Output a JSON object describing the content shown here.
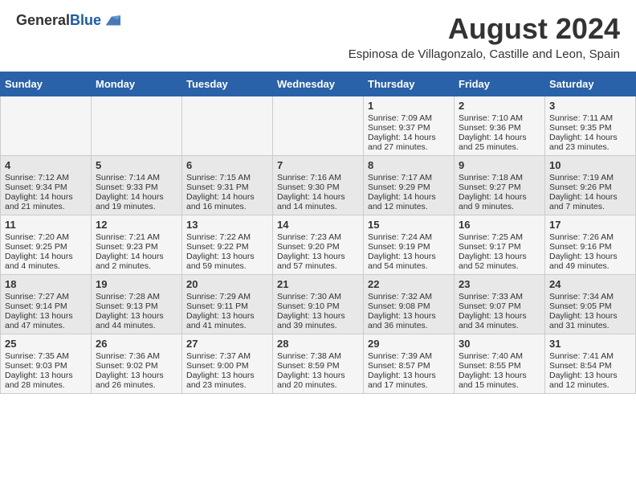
{
  "header": {
    "logo_general": "General",
    "logo_blue": "Blue",
    "month_year": "August 2024",
    "location": "Espinosa de Villagonzalo, Castille and Leon, Spain"
  },
  "days_of_week": [
    "Sunday",
    "Monday",
    "Tuesday",
    "Wednesday",
    "Thursday",
    "Friday",
    "Saturday"
  ],
  "weeks": [
    [
      {
        "day": "",
        "empty": true
      },
      {
        "day": "",
        "empty": true
      },
      {
        "day": "",
        "empty": true
      },
      {
        "day": "",
        "empty": true
      },
      {
        "day": "1",
        "sunrise": "Sunrise: 7:09 AM",
        "sunset": "Sunset: 9:37 PM",
        "daylight": "Daylight: 14 hours and 27 minutes."
      },
      {
        "day": "2",
        "sunrise": "Sunrise: 7:10 AM",
        "sunset": "Sunset: 9:36 PM",
        "daylight": "Daylight: 14 hours and 25 minutes."
      },
      {
        "day": "3",
        "sunrise": "Sunrise: 7:11 AM",
        "sunset": "Sunset: 9:35 PM",
        "daylight": "Daylight: 14 hours and 23 minutes."
      }
    ],
    [
      {
        "day": "4",
        "sunrise": "Sunrise: 7:12 AM",
        "sunset": "Sunset: 9:34 PM",
        "daylight": "Daylight: 14 hours and 21 minutes."
      },
      {
        "day": "5",
        "sunrise": "Sunrise: 7:14 AM",
        "sunset": "Sunset: 9:33 PM",
        "daylight": "Daylight: 14 hours and 19 minutes."
      },
      {
        "day": "6",
        "sunrise": "Sunrise: 7:15 AM",
        "sunset": "Sunset: 9:31 PM",
        "daylight": "Daylight: 14 hours and 16 minutes."
      },
      {
        "day": "7",
        "sunrise": "Sunrise: 7:16 AM",
        "sunset": "Sunset: 9:30 PM",
        "daylight": "Daylight: 14 hours and 14 minutes."
      },
      {
        "day": "8",
        "sunrise": "Sunrise: 7:17 AM",
        "sunset": "Sunset: 9:29 PM",
        "daylight": "Daylight: 14 hours and 12 minutes."
      },
      {
        "day": "9",
        "sunrise": "Sunrise: 7:18 AM",
        "sunset": "Sunset: 9:27 PM",
        "daylight": "Daylight: 14 hours and 9 minutes."
      },
      {
        "day": "10",
        "sunrise": "Sunrise: 7:19 AM",
        "sunset": "Sunset: 9:26 PM",
        "daylight": "Daylight: 14 hours and 7 minutes."
      }
    ],
    [
      {
        "day": "11",
        "sunrise": "Sunrise: 7:20 AM",
        "sunset": "Sunset: 9:25 PM",
        "daylight": "Daylight: 14 hours and 4 minutes."
      },
      {
        "day": "12",
        "sunrise": "Sunrise: 7:21 AM",
        "sunset": "Sunset: 9:23 PM",
        "daylight": "Daylight: 14 hours and 2 minutes."
      },
      {
        "day": "13",
        "sunrise": "Sunrise: 7:22 AM",
        "sunset": "Sunset: 9:22 PM",
        "daylight": "Daylight: 13 hours and 59 minutes."
      },
      {
        "day": "14",
        "sunrise": "Sunrise: 7:23 AM",
        "sunset": "Sunset: 9:20 PM",
        "daylight": "Daylight: 13 hours and 57 minutes."
      },
      {
        "day": "15",
        "sunrise": "Sunrise: 7:24 AM",
        "sunset": "Sunset: 9:19 PM",
        "daylight": "Daylight: 13 hours and 54 minutes."
      },
      {
        "day": "16",
        "sunrise": "Sunrise: 7:25 AM",
        "sunset": "Sunset: 9:17 PM",
        "daylight": "Daylight: 13 hours and 52 minutes."
      },
      {
        "day": "17",
        "sunrise": "Sunrise: 7:26 AM",
        "sunset": "Sunset: 9:16 PM",
        "daylight": "Daylight: 13 hours and 49 minutes."
      }
    ],
    [
      {
        "day": "18",
        "sunrise": "Sunrise: 7:27 AM",
        "sunset": "Sunset: 9:14 PM",
        "daylight": "Daylight: 13 hours and 47 minutes."
      },
      {
        "day": "19",
        "sunrise": "Sunrise: 7:28 AM",
        "sunset": "Sunset: 9:13 PM",
        "daylight": "Daylight: 13 hours and 44 minutes."
      },
      {
        "day": "20",
        "sunrise": "Sunrise: 7:29 AM",
        "sunset": "Sunset: 9:11 PM",
        "daylight": "Daylight: 13 hours and 41 minutes."
      },
      {
        "day": "21",
        "sunrise": "Sunrise: 7:30 AM",
        "sunset": "Sunset: 9:10 PM",
        "daylight": "Daylight: 13 hours and 39 minutes."
      },
      {
        "day": "22",
        "sunrise": "Sunrise: 7:32 AM",
        "sunset": "Sunset: 9:08 PM",
        "daylight": "Daylight: 13 hours and 36 minutes."
      },
      {
        "day": "23",
        "sunrise": "Sunrise: 7:33 AM",
        "sunset": "Sunset: 9:07 PM",
        "daylight": "Daylight: 13 hours and 34 minutes."
      },
      {
        "day": "24",
        "sunrise": "Sunrise: 7:34 AM",
        "sunset": "Sunset: 9:05 PM",
        "daylight": "Daylight: 13 hours and 31 minutes."
      }
    ],
    [
      {
        "day": "25",
        "sunrise": "Sunrise: 7:35 AM",
        "sunset": "Sunset: 9:03 PM",
        "daylight": "Daylight: 13 hours and 28 minutes."
      },
      {
        "day": "26",
        "sunrise": "Sunrise: 7:36 AM",
        "sunset": "Sunset: 9:02 PM",
        "daylight": "Daylight: 13 hours and 26 minutes."
      },
      {
        "day": "27",
        "sunrise": "Sunrise: 7:37 AM",
        "sunset": "Sunset: 9:00 PM",
        "daylight": "Daylight: 13 hours and 23 minutes."
      },
      {
        "day": "28",
        "sunrise": "Sunrise: 7:38 AM",
        "sunset": "Sunset: 8:59 PM",
        "daylight": "Daylight: 13 hours and 20 minutes."
      },
      {
        "day": "29",
        "sunrise": "Sunrise: 7:39 AM",
        "sunset": "Sunset: 8:57 PM",
        "daylight": "Daylight: 13 hours and 17 minutes."
      },
      {
        "day": "30",
        "sunrise": "Sunrise: 7:40 AM",
        "sunset": "Sunset: 8:55 PM",
        "daylight": "Daylight: 13 hours and 15 minutes."
      },
      {
        "day": "31",
        "sunrise": "Sunrise: 7:41 AM",
        "sunset": "Sunset: 8:54 PM",
        "daylight": "Daylight: 13 hours and 12 minutes."
      }
    ]
  ]
}
